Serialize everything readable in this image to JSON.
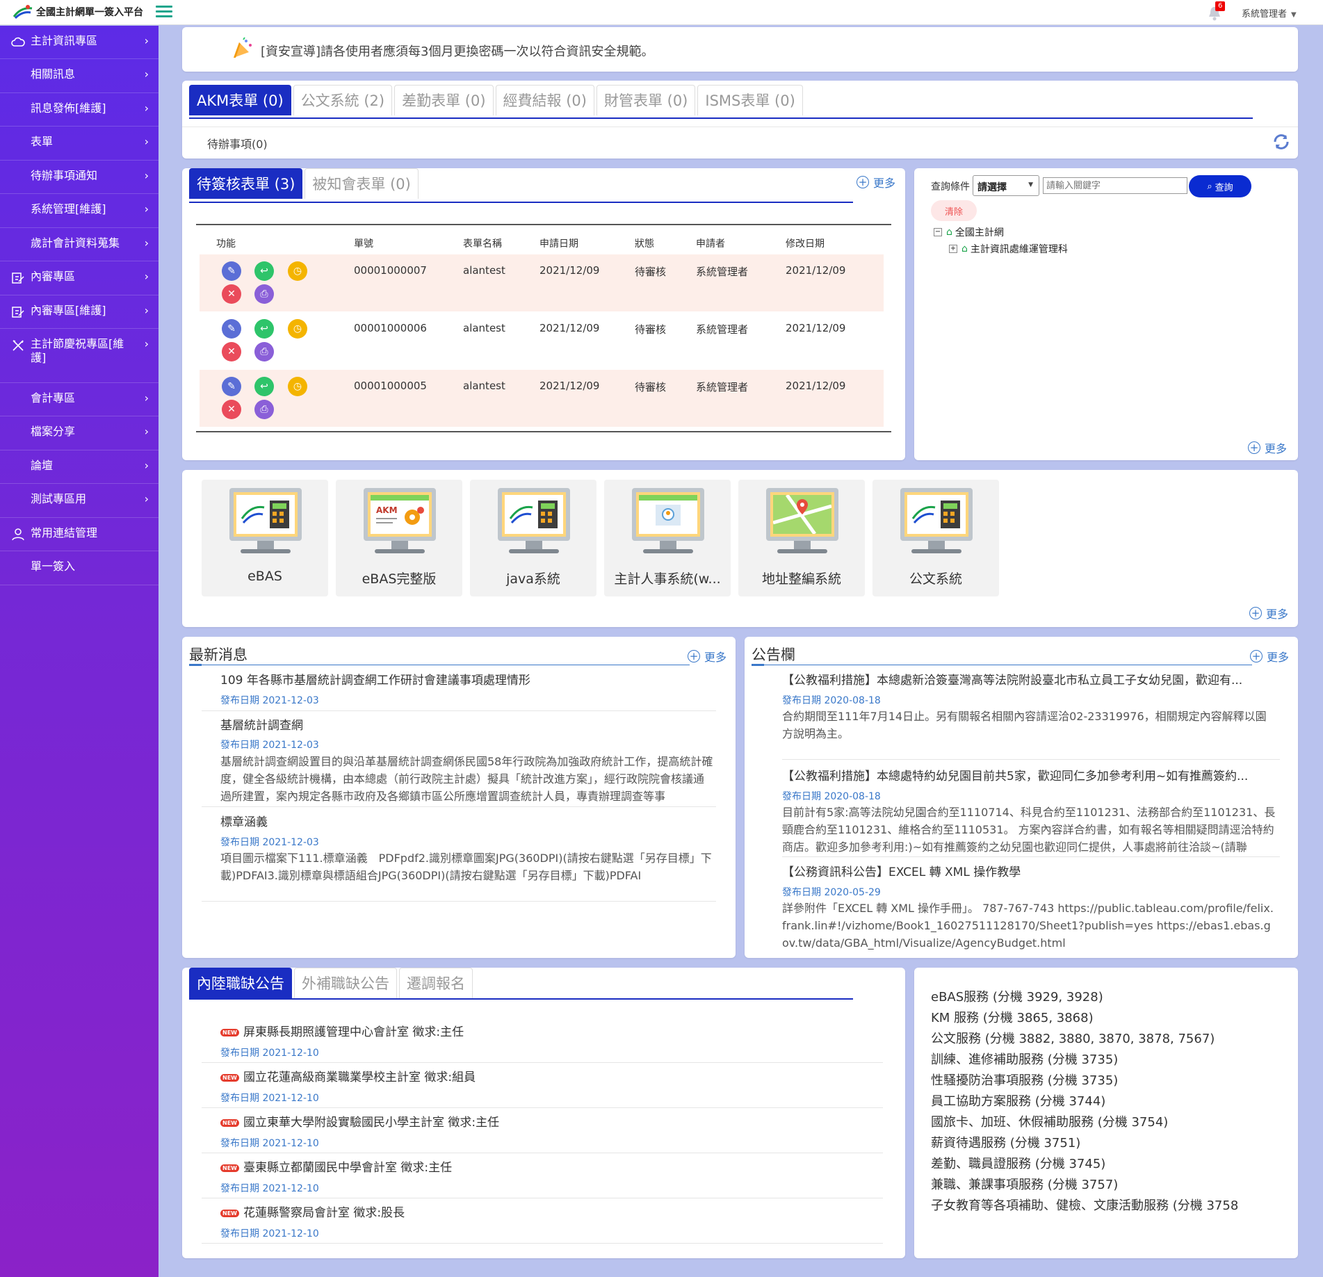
{
  "topbar": {
    "title": "全國主計網單一簽入平台",
    "notification_count": "6",
    "user": "系統管理者"
  },
  "sidebar": {
    "items": [
      {
        "label": "主計資訊專區",
        "icon": "cloud-icon"
      },
      {
        "label": "相關訊息",
        "icon": ""
      },
      {
        "label": "訊息發佈[維護]",
        "icon": ""
      },
      {
        "label": "表單",
        "icon": ""
      },
      {
        "label": "待辦事項通知",
        "icon": ""
      },
      {
        "label": "系統管理[維護]",
        "icon": ""
      },
      {
        "label": "歲計會計資料蒐集",
        "icon": ""
      },
      {
        "label": "內審專區",
        "icon": "edit-doc-icon"
      },
      {
        "label": "內審專區[維護]",
        "icon": "edit-doc-icon"
      },
      {
        "label": "主計節慶祝專區[維護]",
        "icon": "tools-icon"
      },
      {
        "label": "會計專區",
        "icon": ""
      },
      {
        "label": "檔案分享",
        "icon": ""
      },
      {
        "label": "論壇",
        "icon": ""
      },
      {
        "label": "測試專區用",
        "icon": ""
      },
      {
        "label": "常用連結管理",
        "icon": "user-icon"
      },
      {
        "label": "單一簽入",
        "icon": ""
      }
    ]
  },
  "announcement": "[資安宣導]請各使用者應須每3個月更換密碼一次以符合資訊安全規範。",
  "form_tabs": [
    "AKM表單 (0)",
    "公文系統 (2)",
    "差勤表單 (0)",
    "經費結報 (0)",
    "財管表單 (0)",
    "ISMS表單 (0)"
  ],
  "todo_label": "待辦事項(0)",
  "sign_tabs": [
    "待簽核表單 (3)",
    "被知會表單 (0)"
  ],
  "more_label": "更多",
  "table": {
    "headers": [
      "功能",
      "單號",
      "表單名稱",
      "申請日期",
      "狀態",
      "申請者",
      "修改日期"
    ],
    "rows": [
      {
        "no": "00001000007",
        "form": "alantest",
        "date": "2021/12/09",
        "status": "待審核",
        "applicant": "系統管理者",
        "modified": "2021/12/09"
      },
      {
        "no": "00001000006",
        "form": "alantest",
        "date": "2021/12/09",
        "status": "待審核",
        "applicant": "系統管理者",
        "modified": "2021/12/09"
      },
      {
        "no": "00001000005",
        "form": "alantest",
        "date": "2021/12/09",
        "status": "待審核",
        "applicant": "系統管理者",
        "modified": "2021/12/09"
      }
    ]
  },
  "query": {
    "label": "查詢條件",
    "select_value": "請選擇",
    "input_placeholder": "請輸入關鍵字",
    "search_label": "查詢",
    "clear_label": "清除",
    "tree_root": "全國主計網",
    "tree_child": "主計資訊處維運管理科"
  },
  "systems": [
    "eBAS",
    "eBAS完整版",
    "java系統",
    "主計人事系統(w...",
    "地址整編系統",
    "公文系統"
  ],
  "news": {
    "title": "最新消息",
    "items": [
      {
        "title": "109 年各縣市基層統計調查網工作研討會建議事項處理情形",
        "date": "發布日期 2021-12-03",
        "body": ""
      },
      {
        "title": "基層統計調查網",
        "date": "發布日期 2021-12-03",
        "body": "基層統計調查網設置目的與沿革基層統計調查網係民國58年行政院為加強政府統計工作，提高統計確度，健全各級統計機構，由本總處（前行政院主計處）擬具「統計改進方案」，經行政院院會核議通過所建置，案內規定各縣市政府及各鄉鎮市區公所應增置調查統計人員，專責辦理調查等事"
      },
      {
        "title": "標章涵義",
        "date": "發布日期 2021-12-03",
        "body": "項目圖示檔案下111.標章涵義　PDFpdf2.識別標章圖案JPG(360DPI)(請按右鍵點選「另存目標」下載)PDFAI3.識別標章與標語組合JPG(360DPI)(請按右鍵點選「另存目標」下載)PDFAI"
      }
    ]
  },
  "bulletin": {
    "title": "公告欄",
    "items": [
      {
        "title": "【公教福利措施】本總處新洽簽臺灣高等法院附設臺北市私立員工子女幼兒園，歡迎有...",
        "date": "發布日期 2020-08-18",
        "body": "合約期間至111年7月14日止。另有關報名相關內容請逕洽02-23319976，相關規定內容解釋以園方說明為主。"
      },
      {
        "title": "【公教福利措施】本總處特約幼兒園目前共5家，歡迎同仁多加參考利用~如有推薦簽約...",
        "date": "發布日期 2020-08-18",
        "body": "目前計有5家:高等法院幼兒園合約至1110714、科見合約至1101231、法務部合約至1101231、長頸鹿合約至1101231、維格合約至1110531。 方案內容詳合約書，如有報名等相關疑問請逕洽特約商店。歡迎多加參考利用:)~如有推薦簽約之幼兒園也歡迎同仁提供，人事處將前往洽談~(請聯"
      },
      {
        "title": "【公務資訊科公告】EXCEL 轉 XML 操作教學",
        "date": "發布日期 2020-05-29",
        "body": "詳參附件「EXCEL 轉 XML 操作手冊」。 787-767-743 https://public.tableau.com/profile/felix.frank.lin#!/vizhome/Book1_16027511128170/Sheet1?publish=yes https://ebas1.ebas.gov.tw/data/GBA_html/Visualize/AgencyBudget.html"
      }
    ]
  },
  "jobs": {
    "tabs": [
      "內陸職缺公告",
      "外補職缺公告",
      "遷調報名"
    ],
    "items": [
      {
        "title": "屏東縣長期照護管理中心會計室 徵求:主任",
        "date": "發布日期 2021-12-10"
      },
      {
        "title": "國立花蓮高級商業職業學校主計室 徵求:組員",
        "date": "發布日期 2021-12-10"
      },
      {
        "title": "國立東華大學附設實驗國民小學主計室 徵求:主任",
        "date": "發布日期 2021-12-10"
      },
      {
        "title": "臺東縣立都蘭國民中學會計室 徵求:主任",
        "date": "發布日期 2021-12-10"
      },
      {
        "title": "花蓮縣警察局會計室 徵求:股長",
        "date": "發布日期 2021-12-10"
      }
    ],
    "new_badge": "NEW"
  },
  "services": [
    "eBAS服務 (分機 3929, 3928)",
    "KM 服務 (分機 3865, 3868)",
    "公文服務 (分機 3882, 3880, 3870, 3878, 7567)",
    "訓練、進修補助服務 (分機 3735)",
    "性騷擾防治事項服務 (分機 3735)",
    "員工協助方案服務 (分機 3744)",
    "國旅卡、加班、休假補助服務 (分機 3754)",
    "薪資待遇服務 (分機 3751)",
    "差勤、職員證服務 (分機 3745)",
    "兼職、兼課事項服務 (分機 3757)",
    "子女教育等各項補助、健檢、文康活動服務 (分機 3758"
  ],
  "colors": {
    "accent": "#1a2dc2",
    "link": "#3a78c9",
    "sidebar_top": "#5d2be6",
    "sidebar_bottom": "#8b22c8",
    "row_highlight": "#fdeee9"
  }
}
